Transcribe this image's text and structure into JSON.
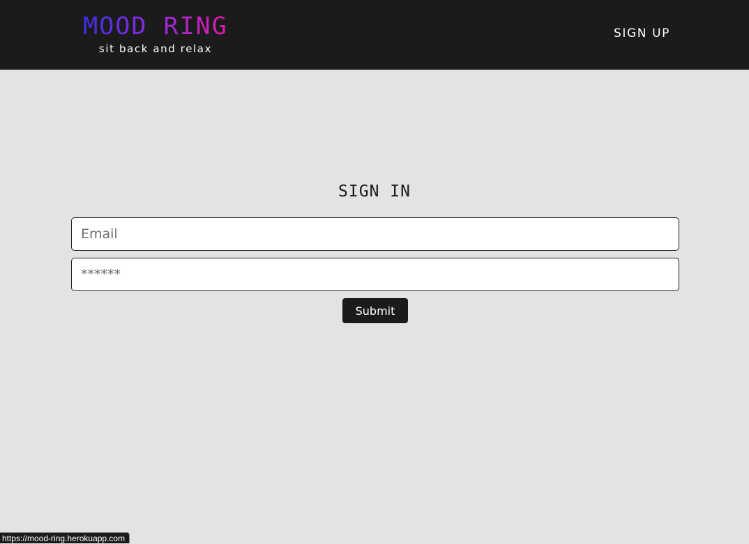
{
  "header": {
    "brand_title": "MOOD RING",
    "brand_tagline": "sit back and relax",
    "nav_signup_label": "SIGN UP",
    "brand_gradient": [
      "#3a2ee6",
      "#8a2be2",
      "#e01aa8"
    ],
    "background_color": "#1b1b1b"
  },
  "form": {
    "title": "SIGN IN",
    "email_placeholder": "Email",
    "email_value": "",
    "password_placeholder": "******",
    "password_value": "",
    "submit_label": "Submit"
  },
  "status_bar": {
    "url": "https://mood-ring.herokuapp.com"
  },
  "colors": {
    "page_background": "#e3e3e3",
    "button_background": "#1b1b1b"
  }
}
